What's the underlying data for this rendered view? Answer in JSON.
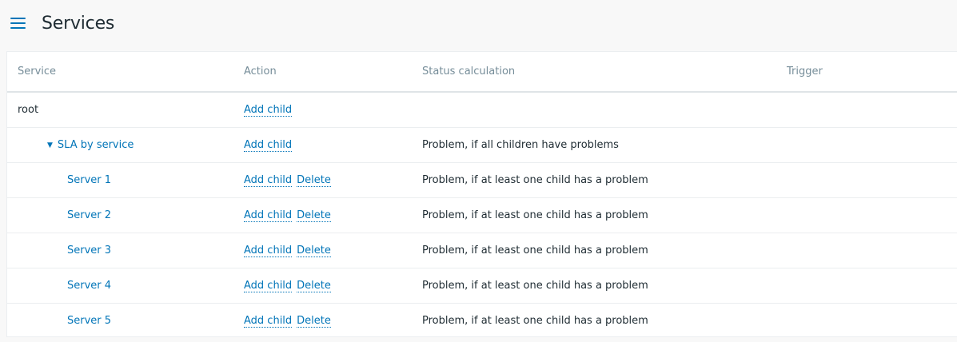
{
  "header": {
    "title": "Services",
    "menu_icon": "hamburger-icon"
  },
  "table": {
    "columns": [
      "Service",
      "Action",
      "Status calculation",
      "Trigger"
    ],
    "rows": [
      {
        "name": "root",
        "level": 0,
        "actions": [
          "Add child"
        ],
        "status": "",
        "trigger": ""
      },
      {
        "name": "SLA by service",
        "level": 1,
        "actions": [
          "Add child"
        ],
        "status": "Problem, if all children have problems",
        "trigger": ""
      },
      {
        "name": "Server 1",
        "level": 2,
        "actions": [
          "Add child",
          "Delete"
        ],
        "status": "Problem, if at least one child has a problem",
        "trigger": ""
      },
      {
        "name": "Server 2",
        "level": 2,
        "actions": [
          "Add child",
          "Delete"
        ],
        "status": "Problem, if at least one child has a problem",
        "trigger": ""
      },
      {
        "name": "Server 3",
        "level": 2,
        "actions": [
          "Add child",
          "Delete"
        ],
        "status": "Problem, if at least one child has a problem",
        "trigger": ""
      },
      {
        "name": "Server 4",
        "level": 2,
        "actions": [
          "Add child",
          "Delete"
        ],
        "status": "Problem, if at least one child has a problem",
        "trigger": ""
      },
      {
        "name": "Server 5",
        "level": 2,
        "actions": [
          "Add child",
          "Delete"
        ],
        "status": "Problem, if at least one child has a problem",
        "trigger": ""
      }
    ]
  },
  "colors": {
    "accent": "#0275b8",
    "header_text": "#768d99",
    "text": "#1f2c33"
  }
}
